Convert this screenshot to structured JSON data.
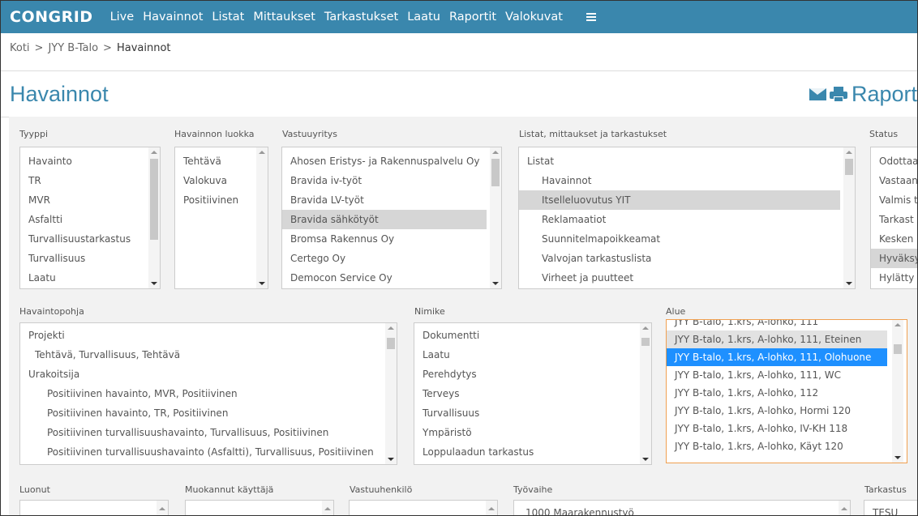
{
  "app": {
    "logo": "CONGRID"
  },
  "nav": {
    "items": [
      "Live",
      "Havainnot",
      "Listat",
      "Mittaukset",
      "Tarkastukset",
      "Laatu",
      "Raportit",
      "Valokuvat"
    ]
  },
  "breadcrumb": {
    "items": [
      "Koti",
      "JYY B-Talo",
      "Havainnot"
    ],
    "separator": ">"
  },
  "page": {
    "title": "Havainnot",
    "raport_label": "Raport"
  },
  "colors": {
    "brand": "#3a87ad",
    "selected_blue": "#1e90ff",
    "active_border": "#f0a050"
  },
  "filters": {
    "tyyppi": {
      "label": "Tyyppi",
      "options": [
        "Havainto",
        "TR",
        "MVR",
        "Asfaltti",
        "Turvallisuustarkastus",
        "Turvallisuus",
        "Laatu"
      ]
    },
    "luokka": {
      "label": "Havainnon luokka",
      "options": [
        "Tehtävä",
        "Valokuva",
        "Positiivinen"
      ]
    },
    "vastuuyritys": {
      "label": "Vastuuyritys",
      "options": [
        "Ahosen Eristys- ja Rakennuspalvelu Oy",
        "Bravida iv-työt",
        "Bravida LV-työt",
        "Bravida sähkötyöt",
        "Bromsa Rakennus Oy",
        "Certego Oy",
        "Democon Service Oy"
      ],
      "selected": "Bravida sähkötyöt"
    },
    "listat": {
      "label": "Listat, mittaukset ja tarkastukset",
      "options": [
        "Listat",
        "Havainnot",
        "Itselleluovutus YIT",
        "Reklamaatiot",
        "Suunnitelmapoikkeamat",
        "Valvojan tarkastuslista",
        "Virheet ja puutteet"
      ],
      "selected": "Itselleluovutus YIT"
    },
    "status": {
      "label": "Status",
      "options": [
        "Odottaa",
        "Vastaan",
        "Valmis t",
        "Tarkast",
        "Kesken",
        "Hyväksy",
        "Hylätty"
      ],
      "selected": "Hyväksy"
    },
    "havaintopohja": {
      "label": "Havaintopohja",
      "options": [
        "Projekti",
        "Tehtävä, Turvallisuus, Tehtävä",
        "Urakoitsija",
        "Positiivinen havainto, MVR, Positiivinen",
        "Positiivinen havainto, TR, Positiivinen",
        "Positiivinen turvallisuushavainto, Turvallisuus, Positiivinen",
        "Positiivinen turvallisuushavainto (Asfaltti), Turvallisuus, Positiivinen"
      ]
    },
    "nimike": {
      "label": "Nimike",
      "options": [
        "Dokumentti",
        "Laatu",
        "Perehdytys",
        "Terveys",
        "Turvallisuus",
        "Ympäristö",
        "Loppulaadun tarkastus"
      ]
    },
    "alue": {
      "label": "Alue",
      "options": [
        "JYY B-talo, 1.krs, A-lohko, 111",
        "JYY B-talo, 1.krs, A-lohko, 111, Eteinen",
        "JYY B-talo, 1.krs, A-lohko, 111, Olohuone",
        "JYY B-talo, 1.krs, A-lohko, 111, WC",
        "JYY B-talo, 1.krs, A-lohko, 112",
        "JYY B-talo, 1.krs, A-lohko, Hormi 120",
        "JYY B-talo, 1.krs, A-lohko, IV-KH 118",
        "JYY B-talo, 1.krs, A-lohko, Käyt 120"
      ],
      "highlighted": "JYY B-talo, 1.krs, A-lohko, 111, Eteinen",
      "selected": "JYY B-talo, 1.krs, A-lohko, 111, Olohuone"
    },
    "luonut": {
      "label": "Luonut"
    },
    "muokannut": {
      "label": "Muokannut käyttäjä"
    },
    "vastuuhenkilo": {
      "label": "Vastuuhenkilö"
    },
    "tyovaihe": {
      "label": "Työvaihe",
      "options": [
        "1000 Maarakennustyö"
      ]
    },
    "tarkastus": {
      "label": "Tarkastus",
      "options": [
        "TESU"
      ]
    }
  }
}
